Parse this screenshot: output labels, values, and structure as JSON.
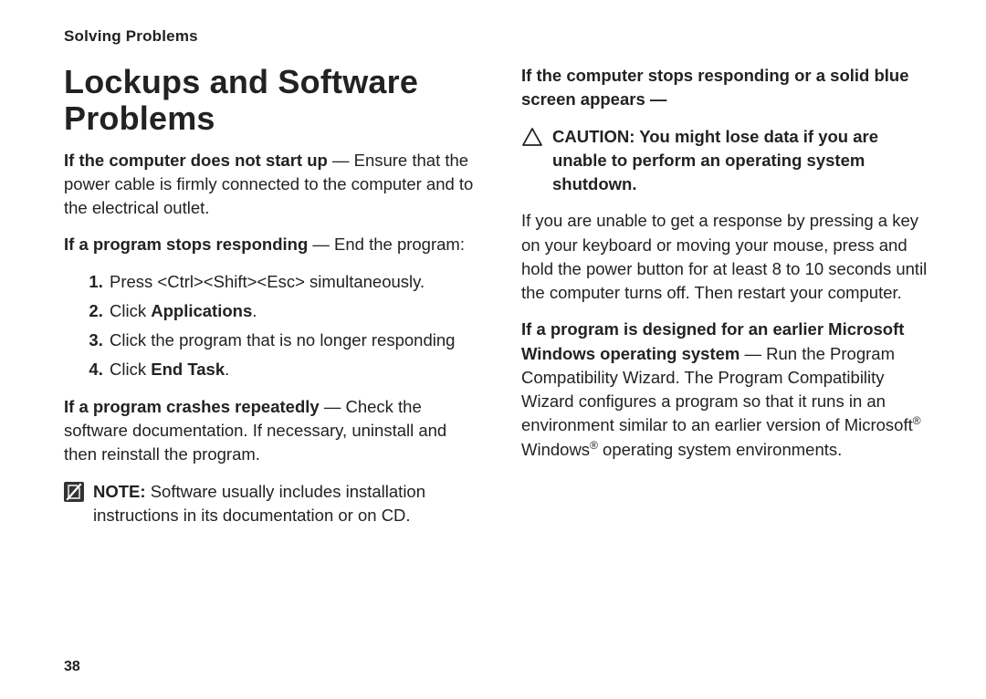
{
  "header": {
    "section": "Solving Problems"
  },
  "page_number": "38",
  "left": {
    "title": "Lockups and Software Problems",
    "p1_bold": "If the computer does not start up",
    "p1_rest": " — Ensure that the power cable is firmly connected to the computer and to the electrical outlet.",
    "p2_bold": "If a program stops responding",
    "p2_rest": " — End the program:",
    "step1": "Press <Ctrl><Shift><Esc> simultaneously.",
    "step2_pre": "Click ",
    "step2_bold": "Applications",
    "step2_post": ".",
    "step3": "Click the program that is no longer responding",
    "step4_pre": "Click ",
    "step4_bold": "End Task",
    "step4_post": ".",
    "p3_bold": "If a program crashes repeatedly",
    "p3_rest": " — Check the software documentation. If necessary, uninstall and then reinstall the program.",
    "note_label": "NOTE:",
    "note_body": " Software usually includes installation instructions in its documentation or on CD."
  },
  "right": {
    "h_bold": "If the computer stops responding or a solid blue screen appears —",
    "caution_label": "CAUTION:",
    "caution_body": " You might lose data if you are unable to perform an operating system shutdown.",
    "p1": "If you are unable to get a response by pressing a key on your keyboard or moving your mouse, press and hold the power button for at least 8 to 10 seconds until the computer turns off. Then restart your computer.",
    "p2_bold": "If a program is designed for an earlier Microsoft Windows operating system",
    "p2_rest_a": " — Run the Program Compatibility Wizard. The Program Compatibility Wizard configures a program so that it runs in an environment similar to an earlier version of Microsoft",
    "p2_reg1": "®",
    "p2_rest_b": " Windows",
    "p2_reg2": "®",
    "p2_rest_c": " operating system environments."
  }
}
